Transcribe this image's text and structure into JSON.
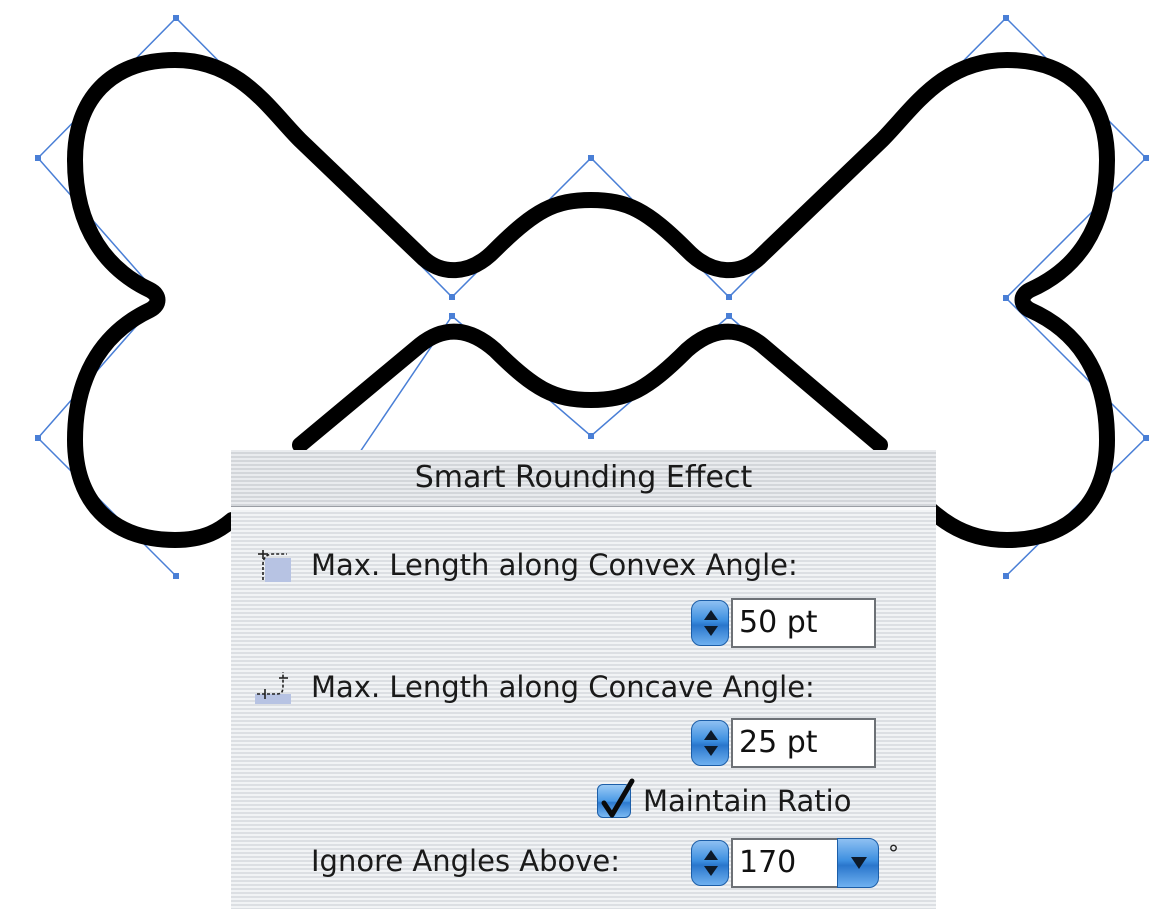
{
  "dialog": {
    "title": "Smart Rounding Effect",
    "convex": {
      "label": "Max. Length along Convex Angle:",
      "icon": "convex-angle-icon",
      "value": "50 pt"
    },
    "concave": {
      "label": "Max. Length along Concave Angle:",
      "icon": "concave-angle-icon",
      "value": "25 pt"
    },
    "maintain_ratio": {
      "label": "Maintain Ratio",
      "checked": true
    },
    "ignore_angles": {
      "label": "Ignore Angles Above:",
      "value": "170",
      "unit": "°"
    }
  },
  "canvas": {
    "stroke_color": "#000000",
    "control_color": "#4a7fd6"
  }
}
